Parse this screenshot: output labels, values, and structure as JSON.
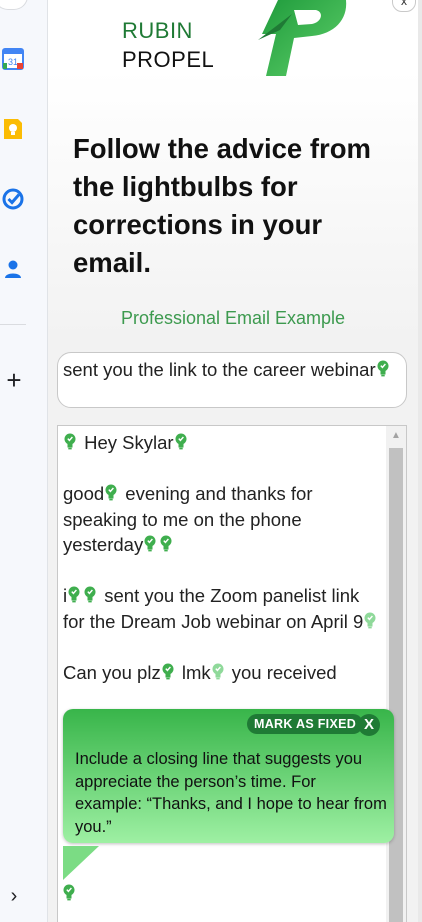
{
  "brand": {
    "line1": "RUBIN",
    "line2": "PROPEL"
  },
  "headline": "Follow the advice from the lightbulbs for corrections in your email.",
  "subtitle": "Professional Email Example",
  "subject": {
    "text": "sent you the link to the career webinar"
  },
  "email_body": {
    "greeting": "Hey Skylar",
    "p1_a": "good",
    "p1_b": "evening and thanks for speaking to me on the phone yesterday",
    "p2_a": "i",
    "p2_b": "sent you the Zoom panelist link for the Dream Job webinar on April 9",
    "p3_a": "Can you plz",
    "p3_b": "lmk",
    "p3_c": "you received"
  },
  "tooltip": {
    "mark_fixed_label": "MARK AS FIXED",
    "close_label": "X",
    "text": "Include a closing line that suggests you appreciate the person’s time. For example: “Thanks, and I hope to hear from you.”"
  },
  "window": {
    "close_label": "x"
  },
  "sidebar": {
    "calendar_label": "31",
    "add_label": "+",
    "expand_label": "›"
  },
  "colors": {
    "brand_green": "#1f7a35",
    "accent_green": "#3d9a4f",
    "bulb_green": "#3fae4e",
    "bulb_light": "#8fd99a"
  }
}
